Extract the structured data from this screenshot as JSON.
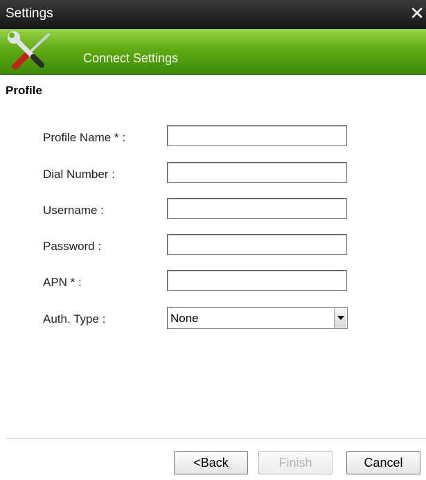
{
  "window": {
    "title": "Settings",
    "close_glyph": "✕"
  },
  "banner": {
    "title": "Connect Settings",
    "icon": "wrench-screwdriver-icon"
  },
  "section": {
    "title": "Profile"
  },
  "fields": [
    {
      "label": "Profile Name * :",
      "value": ""
    },
    {
      "label": "Dial Number :",
      "value": ""
    },
    {
      "label": "Username :",
      "value": ""
    },
    {
      "label": "Password :",
      "value": ""
    },
    {
      "label": "APN * :",
      "value": ""
    }
  ],
  "auth": {
    "label": "Auth. Type :",
    "selected": "None"
  },
  "buttons": {
    "back": "<Back",
    "finish": "Finish",
    "cancel": "Cancel"
  },
  "colors": {
    "banner_green": "#5fab14",
    "titlebar": "#1a1a1a"
  }
}
